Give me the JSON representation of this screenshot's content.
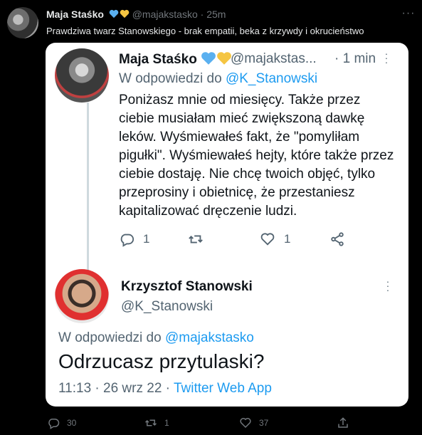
{
  "outer": {
    "author_name": "Maja Staśko",
    "handle": "@majakstasko",
    "separator": "·",
    "time": "25m",
    "text": "Prawdziwa twarz Stanowskiego - brak empatii, beka z krzywdy i okrucieństwo",
    "menu": "···",
    "actions": {
      "replies": "30",
      "retweets": "1",
      "likes": "37"
    }
  },
  "quoted_tweet": {
    "author_name": "Maja Staśko",
    "handle": "@majakstas...",
    "time": "· 1 min",
    "reply_prefix": "W odpowiedzi do ",
    "reply_to": "@K_Stanowski",
    "text": "Poniżasz mnie od miesięcy. Także przez ciebie musiałam mieć zwiększoną dawkę leków. Wyśmiewałeś fakt, że \"pomyliłam pigułki\". Wyśmiewałeś hejty, które także przez ciebie dostaję. Nie chcę twoich objęć, tylko przeprosiny i obietnicę, że przestaniesz kapitalizować dręczenie ludzi.",
    "replies": "1",
    "likes": "1"
  },
  "reply_tweet": {
    "author_name": "Krzysztof Stanowski",
    "handle": "@K_Stanowski",
    "reply_prefix": "W odpowiedzi do ",
    "reply_to": "@majakstasko",
    "text": "Odrzucasz przytulaski?",
    "date": "11:13 · 26 wrz 22 · ",
    "source": "Twitter Web App"
  },
  "colors": {
    "heart_blue": "#5ab0f0",
    "heart_yellow": "#f5c542",
    "link": "#1d9bf0"
  }
}
